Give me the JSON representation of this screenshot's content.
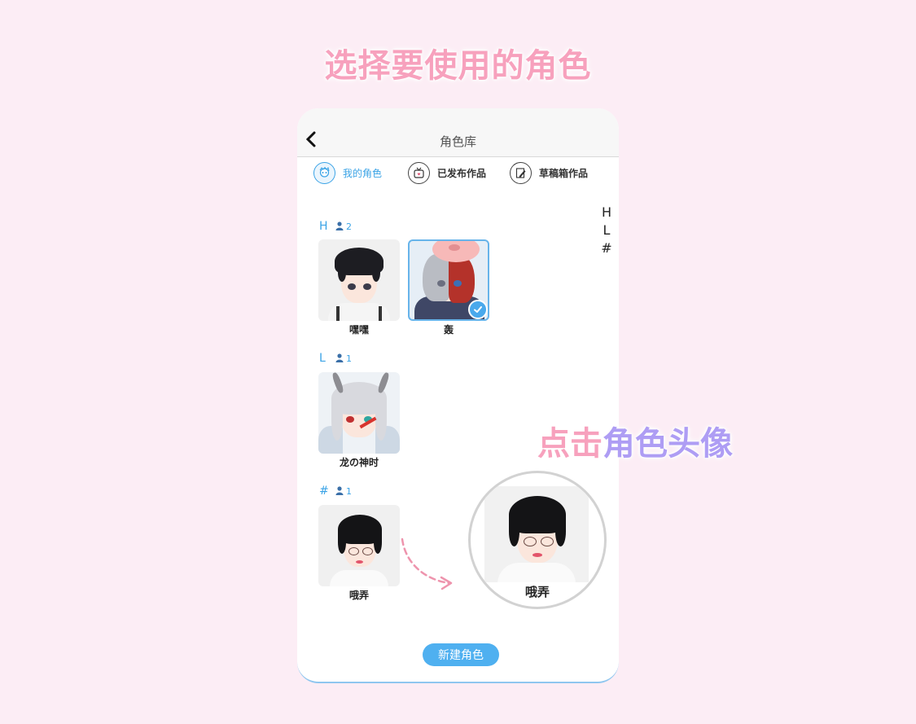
{
  "headline": "选择要使用的角色",
  "topbar": {
    "title": "角色库",
    "back_icon": "back-chevron-icon"
  },
  "tabs": [
    {
      "label": "我的角色",
      "icon": "my-avatar-icon",
      "active": true
    },
    {
      "label": "已发布作品",
      "icon": "tv-icon",
      "active": false
    },
    {
      "label": "草稿箱作品",
      "icon": "draft-pencil-icon",
      "active": false
    }
  ],
  "index": [
    "H",
    "L",
    "#"
  ],
  "sections": [
    {
      "letter": "H",
      "count": "2",
      "characters": [
        {
          "name": "嘿嘿",
          "selected": false
        },
        {
          "name": "轰",
          "selected": true
        }
      ]
    },
    {
      "letter": "L",
      "count": "1",
      "characters": [
        {
          "name": "龙の神时",
          "selected": false
        }
      ]
    },
    {
      "letter": "#",
      "count": "1",
      "characters": [
        {
          "name": "哦弄",
          "selected": false
        }
      ]
    }
  ],
  "new_button": "新建角色",
  "callout": {
    "first": "点击",
    "rest": "角色头像"
  },
  "zoom": {
    "name": "哦弄"
  },
  "colors": {
    "accent": "#3aa3e6",
    "button": "#4fb0f0",
    "headline": "#f7a1bd",
    "callout_rest": "#ae9df4",
    "background": "#fcedf5"
  }
}
